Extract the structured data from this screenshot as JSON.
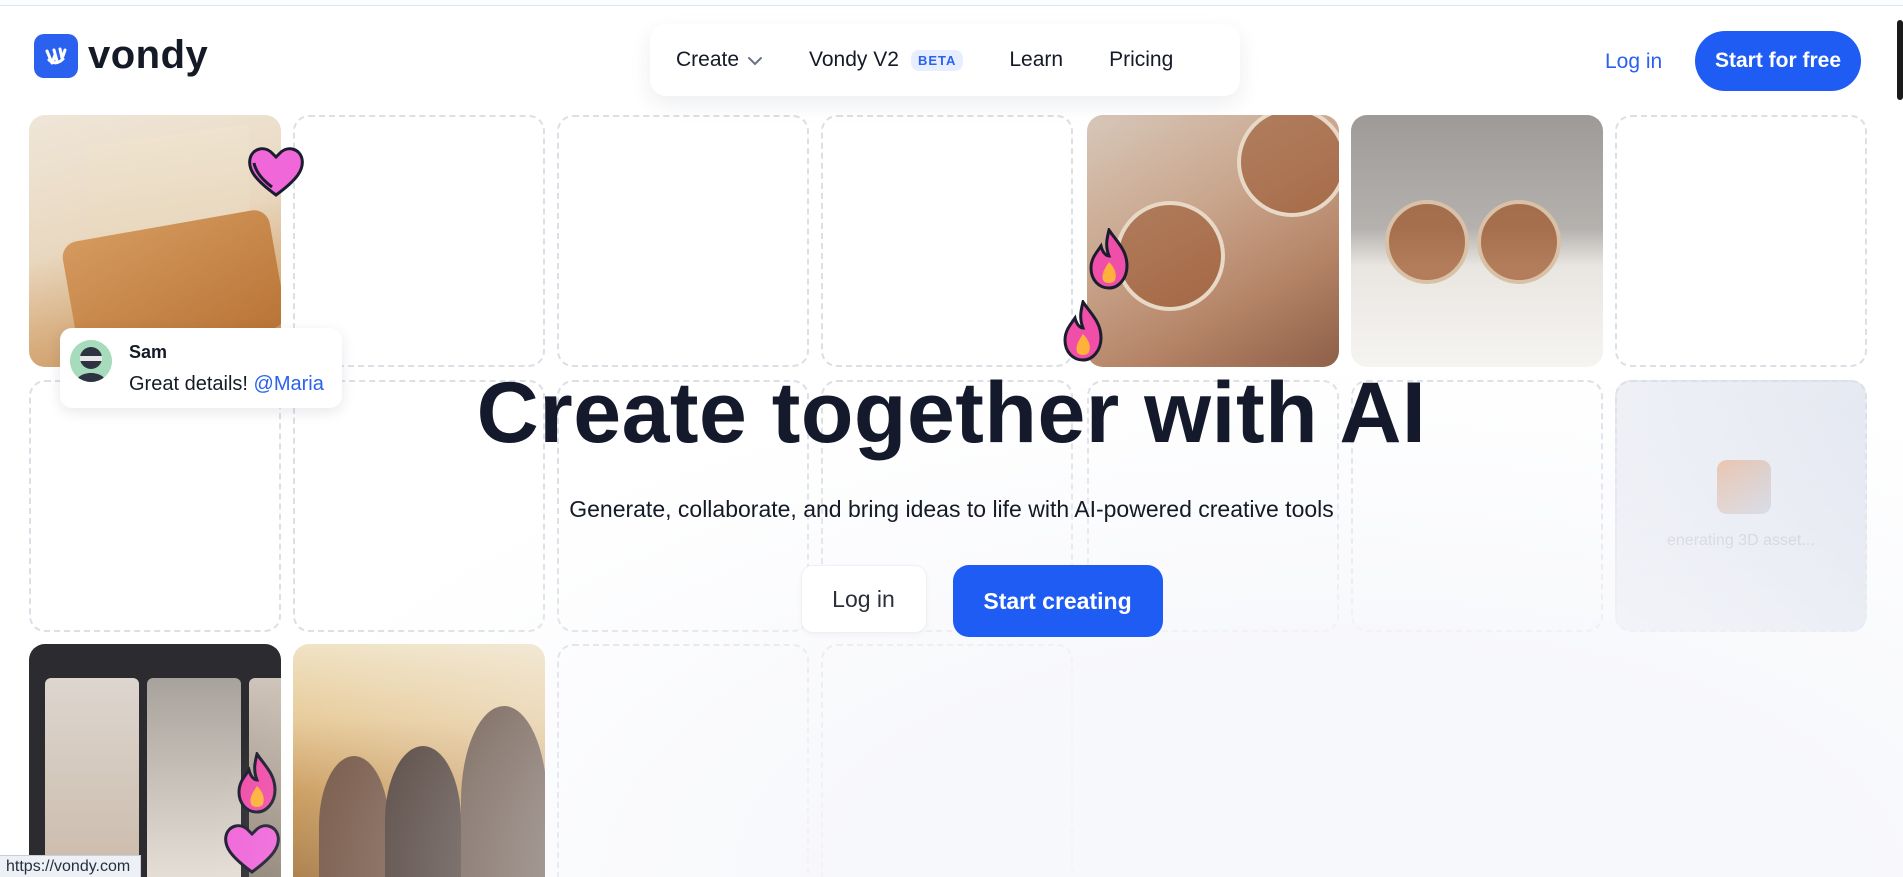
{
  "header": {
    "logo_text": "vondy",
    "nav": [
      {
        "label": "Create"
      },
      {
        "label": "Vondy V2",
        "badge": "BETA"
      },
      {
        "label": "Learn"
      },
      {
        "label": "Pricing"
      }
    ],
    "login_label": "Log in",
    "cta_label": "Start for free"
  },
  "comment": {
    "name": "Sam",
    "message": "Great details!",
    "mention": "@Maria"
  },
  "generating_text": "enerating 3D asset...",
  "hero": {
    "title": "Create together with AI",
    "subtitle": "Generate, collaborate, and bring ideas to life with AI-powered creative tools",
    "login_label": "Log in",
    "primary_label": "Start creating"
  },
  "status_bar": {
    "url": "https://vondy.com"
  },
  "colors": {
    "accent": "#1f5cf4",
    "text": "#141a26",
    "tile_border": "#dcdfe6"
  },
  "icons": [
    "vondy-logo-icon",
    "chevron-down-icon",
    "heart-icon",
    "fire-icon"
  ]
}
